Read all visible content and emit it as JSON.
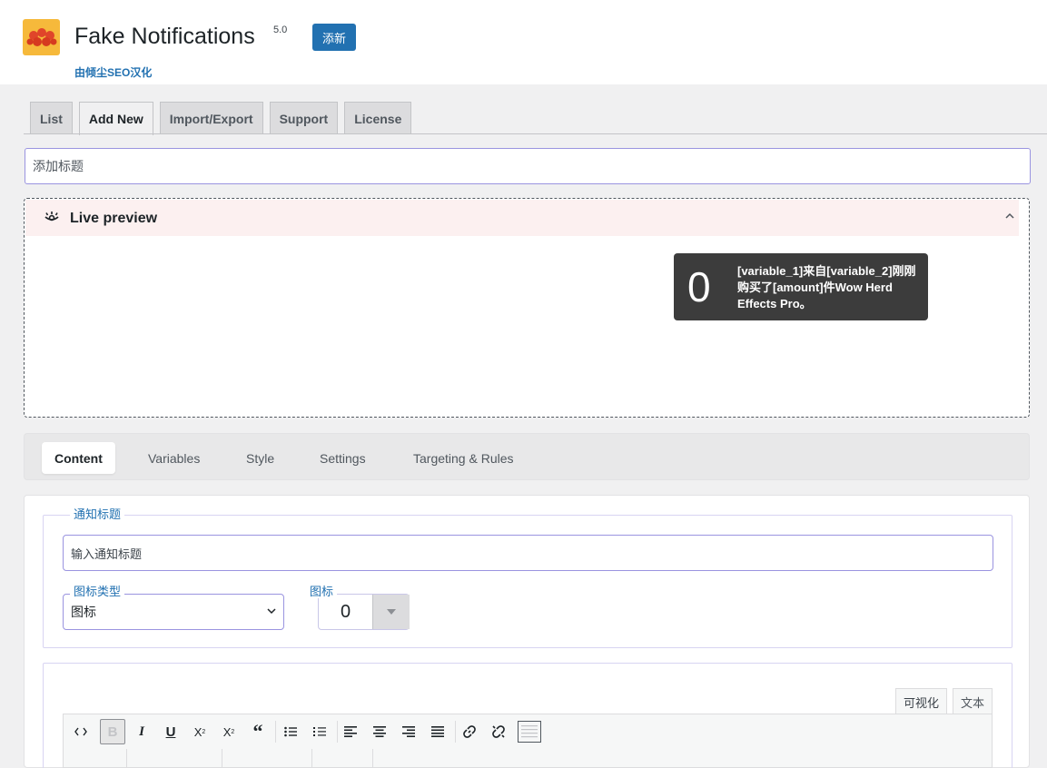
{
  "header": {
    "plugin_title": "Fake Notifications",
    "version": "5.0",
    "add_new_button": "添新",
    "credit": "由倾尘SEO汉化"
  },
  "tabs": [
    {
      "label": "List"
    },
    {
      "label": "Add New"
    },
    {
      "label": "Import/Export"
    },
    {
      "label": "Support"
    },
    {
      "label": "License"
    }
  ],
  "title_input": {
    "placeholder": "添加标题"
  },
  "preview": {
    "title": "Live preview",
    "notification_icon_text": "0",
    "notification_text": "[variable_1]来自[variable_2]刚刚购买了[amount]件Wow Herd Effects Pro。"
  },
  "subtabs": [
    {
      "label": "Content"
    },
    {
      "label": "Variables"
    },
    {
      "label": "Style"
    },
    {
      "label": "Settings"
    },
    {
      "label": "Targeting & Rules"
    }
  ],
  "content": {
    "notification_title_legend": "通知标题",
    "notification_title_placeholder": "输入通知标题",
    "icon_type_legend": "图标类型",
    "icon_type_value": "图标",
    "icon_legend": "图标",
    "icon_value": "0"
  },
  "editor": {
    "visual_tab": "可视化",
    "text_tab": "文本"
  },
  "colors": {
    "accent": "#2271b1",
    "input_border": "#9a94e0",
    "notification_bg": "#3c3c3c",
    "preview_header_bg": "#fcf0f0"
  }
}
